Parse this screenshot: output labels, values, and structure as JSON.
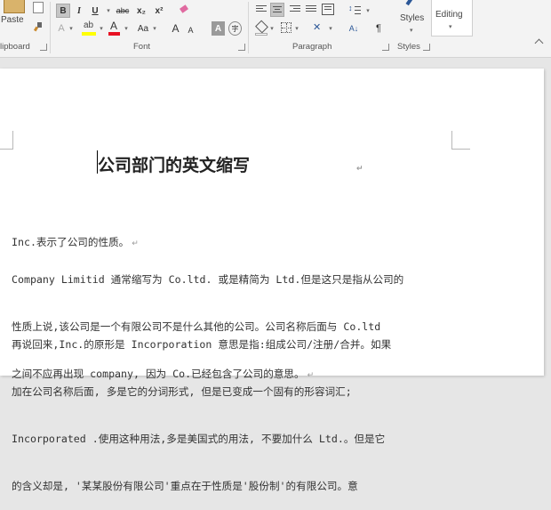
{
  "ribbon": {
    "clipboard": {
      "paste_label": "Paste",
      "group_label": "lipboard"
    },
    "font": {
      "group_label": "Font",
      "bold": "B",
      "italic": "I",
      "underline": "U",
      "strike": "abc",
      "subscript": "x₂",
      "superscript": "x²",
      "text_effects": "A",
      "highlight": "ab",
      "font_color": "A",
      "change_case": "Aa",
      "grow_font": "A",
      "shrink_font": "A",
      "char_shading": "A",
      "enclose": "字"
    },
    "paragraph": {
      "group_label": "Paragraph",
      "sort": "A↓",
      "pilcrow": "¶"
    },
    "styles": {
      "label": "Styles",
      "group_label": "Styles"
    },
    "editing": {
      "label": "Editing"
    },
    "colors": {
      "highlight": "#ffff00",
      "font_color": "#e81123"
    }
  },
  "document": {
    "title": "公司部门的英文缩写",
    "paragraphs": [
      [
        "Inc.表示了公司的性质。"
      ],
      [
        "Company Limitid 通常缩写为 Co.ltd. 或是精简为 Ltd.但是这只是指从公司的",
        "性质上说,该公司是一个有限公司不是什么其他的公司。公司名称后面与 Co.ltd",
        "之间不应再出现 company, 因为 Co.已经包含了公司的意思。"
      ],
      [
        "再说回来,Inc.的原形是 Incorporation 意思是指:组成公司/注册/合并。如果",
        "加在公司名称后面, 多是它的分词形式, 但是已变成一个固有的形容词汇;",
        "Incorporated .使用这种用法,多是美国式的用法, 不要加什么 Ltd.。但是它",
        "的含义却是, '某某股份有限公司'重点在于性质是'股份制'的有限公司。意"
      ]
    ],
    "paragraph_mark": "↵"
  }
}
